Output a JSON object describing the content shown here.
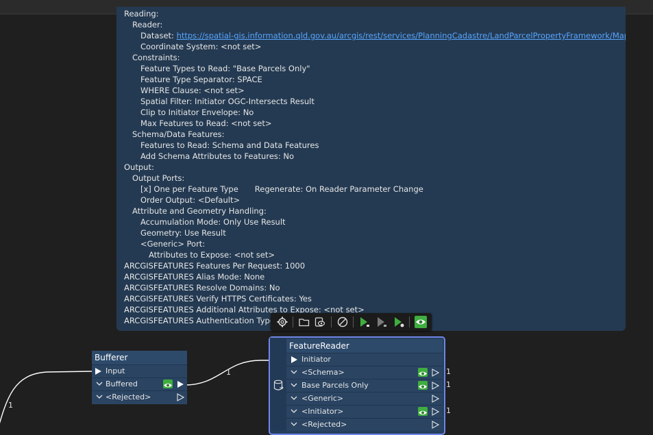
{
  "annotation": {
    "lines": [
      {
        "text": "Reading:",
        "indent": 0
      },
      {
        "text": "Reader:",
        "indent": 1
      },
      {
        "text": "Dataset: ",
        "indent": 2,
        "link": "https://spatial-gis.information.qld.gov.au/arcgis/rest/services/PlanningCadastre/LandParcelPropertyFramework/MapServer"
      },
      {
        "text": "Coordinate System: <not set>",
        "indent": 2
      },
      {
        "text": "Constraints:",
        "indent": 1
      },
      {
        "text": "Feature Types to Read: \"Base Parcels Only\"",
        "indent": 2
      },
      {
        "text": "Feature Type Separator: SPACE",
        "indent": 2
      },
      {
        "text": "WHERE Clause: <not set>",
        "indent": 2
      },
      {
        "text": "Spatial Filter: Initiator OGC-Intersects Result",
        "indent": 2
      },
      {
        "text": "Clip to Initiator Envelope: No",
        "indent": 2
      },
      {
        "text": "Max Features to Read: <not set>",
        "indent": 2
      },
      {
        "text": "Schema/Data Features:",
        "indent": 1
      },
      {
        "text": "Features to Read: Schema and Data Features",
        "indent": 2
      },
      {
        "text": "Add Schema Attributes to Features: No",
        "indent": 2
      },
      {
        "text": "Output:",
        "indent": 0
      },
      {
        "text": "Output Ports:",
        "indent": 1
      },
      {
        "text": "[x] One per Feature Type",
        "indent": 2,
        "extra": "Regenerate: On Reader Parameter Change"
      },
      {
        "text": "Order Output: <Default>",
        "indent": 2
      },
      {
        "text": "Attribute and Geometry Handling:",
        "indent": 1
      },
      {
        "text": "Accumulation Mode: Only Use Result",
        "indent": 2
      },
      {
        "text": "Geometry: Use Result",
        "indent": 2
      },
      {
        "text": "<Generic> Port:",
        "indent": 2
      },
      {
        "text": "Attributes to Expose: <not set>",
        "indent": 3
      },
      {
        "text": "ARCGISFEATURES Features Per Request: 1000",
        "indent": 0
      },
      {
        "text": "ARCGISFEATURES Alias Mode: None",
        "indent": 0
      },
      {
        "text": "ARCGISFEATURES Resolve Domains: No",
        "indent": 0
      },
      {
        "text": "ARCGISFEATURES Verify HTTPS Certificates: Yes",
        "indent": 0
      },
      {
        "text": "ARCGISFEATURES Additional Attributes to Expose: <not set>",
        "indent": 0
      },
      {
        "text": "ARCGISFEATURES Authentication Type: N",
        "indent": 0
      }
    ]
  },
  "toolbar": {
    "buttons": [
      "gear-icon",
      "folder-open-icon",
      "cache-icon",
      "disable-icon",
      "run-to-this-icon",
      "run-from-this-icon",
      "run-partial-icon",
      "inspect-icon"
    ]
  },
  "bufferer": {
    "title": "Bufferer",
    "input_label": "Input",
    "ports": [
      {
        "label": "Buffered",
        "inspect": true
      },
      {
        "label": "<Rejected>",
        "inspect": false
      }
    ]
  },
  "feature_reader": {
    "title": "FeatureReader",
    "input_label": "Initiator",
    "ports": [
      {
        "label": "<Schema>",
        "inspect": true,
        "count": "1"
      },
      {
        "label": "Base Parcels Only",
        "inspect": true,
        "count": "1"
      },
      {
        "label": "<Generic>",
        "inspect": false,
        "count": ""
      },
      {
        "label": "<Initiator>",
        "inspect": true,
        "count": "1"
      },
      {
        "label": "<Rejected>",
        "inspect": false,
        "count": ""
      }
    ]
  },
  "connections": {
    "left_count": "1",
    "middle_count": "1"
  },
  "colors": {
    "canvas": "#1f1f1f",
    "annotation_bg": "#243a52",
    "node_bg": "#2d4a6b",
    "selection": "#6f86e6",
    "inspect_green": "#3fae3f",
    "link": "#58a6ff"
  }
}
